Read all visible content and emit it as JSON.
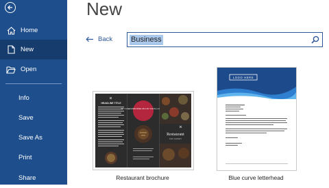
{
  "sidebar": {
    "back_icon": "back-arrow-circle-icon",
    "items": [
      {
        "label": "Home",
        "icon": "home-icon"
      },
      {
        "label": "New",
        "icon": "new-document-icon"
      },
      {
        "label": "Open",
        "icon": "folder-open-icon"
      },
      {
        "label": "Info"
      },
      {
        "label": "Save"
      },
      {
        "label": "Save As"
      },
      {
        "label": "Print"
      },
      {
        "label": "Share"
      }
    ],
    "active": "New"
  },
  "main": {
    "title": "New",
    "back_label": "Back",
    "search": {
      "value": "Business",
      "icon": "search-icon"
    },
    "templates": [
      {
        "caption": "Restaurant brochure",
        "panel_headline": "HEADLINE TITLE",
        "badge_text": "TRY A SECOND DISH ON US! YOU’LL LOVE IT!",
        "brand_text": "Restaurant",
        "brand_sub": "STAY HUNGRY"
      },
      {
        "caption": "Blue curve letterhead",
        "logo_text": "LOGO HERE"
      }
    ]
  },
  "colors": {
    "sidebar_bg": "#1e4e8c",
    "sidebar_active": "#163c6e",
    "accent": "#2b579a",
    "selection": "#a9c8ec"
  }
}
